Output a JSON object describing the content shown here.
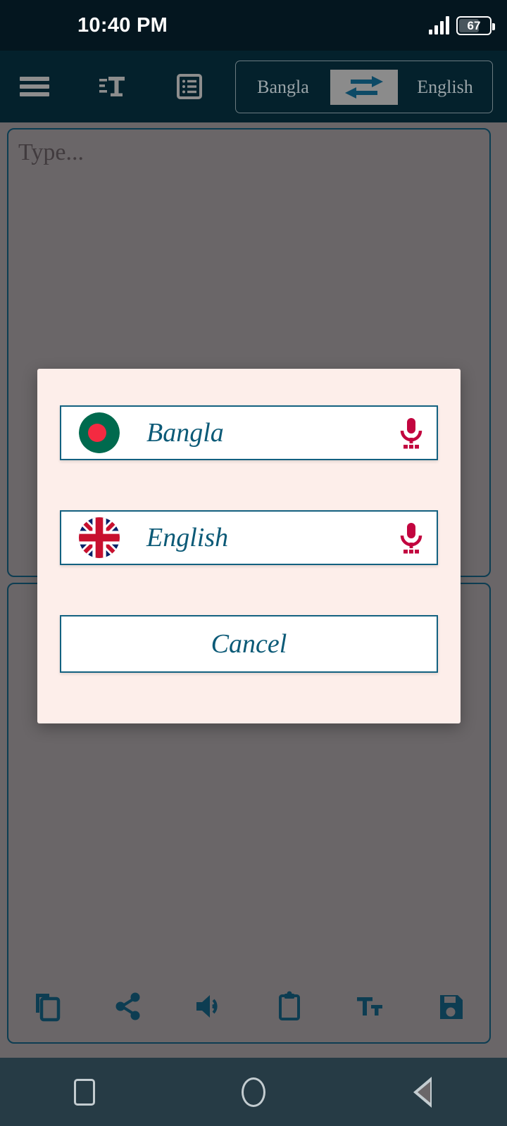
{
  "status_bar": {
    "time": "10:40 PM",
    "battery_percent": "67",
    "signal_icon": "signal-bars-icon",
    "battery_icon": "battery-icon"
  },
  "header": {
    "menu_icon": "hamburger-menu-icon",
    "font_icon": "text-format-icon",
    "dictionary_icon": "dictionary-list-icon",
    "source_language": "Bangla",
    "target_language": "English",
    "swap_icon": "swap-horizontal-icon"
  },
  "editor": {
    "source_placeholder": "Type...",
    "source_value": "",
    "target_value": ""
  },
  "toolbar": {
    "items": [
      {
        "name": "copy-button",
        "icon": "copy-icon"
      },
      {
        "name": "share-button",
        "icon": "share-icon"
      },
      {
        "name": "speak-button",
        "icon": "speaker-icon"
      },
      {
        "name": "paste-button",
        "icon": "clipboard-icon"
      },
      {
        "name": "text-size-button",
        "icon": "text-size-icon"
      },
      {
        "name": "save-button",
        "icon": "floppy-save-icon"
      }
    ]
  },
  "dialog": {
    "visible": true,
    "options": [
      {
        "label": "Bangla",
        "flag": "bangladesh-flag-icon",
        "mic_icon": "microphone-icon"
      },
      {
        "label": "English",
        "flag": "uk-flag-icon",
        "mic_icon": "microphone-icon"
      }
    ],
    "cancel_label": "Cancel"
  },
  "nav_bar": {
    "recents_icon": "square-recents-icon",
    "home_icon": "circle-home-icon",
    "back_icon": "triangle-back-icon"
  },
  "colors": {
    "status_bar_bg": "#04161f",
    "header_bg": "#04212c",
    "page_bg": "#6a6668",
    "accent_border": "#0d3d52",
    "dialog_bg": "#fdeeea",
    "dialog_accent": "#136180",
    "dialog_text": "#0c5a77",
    "mic_red": "#c2053f",
    "nav_bar_bg": "#263b45"
  }
}
